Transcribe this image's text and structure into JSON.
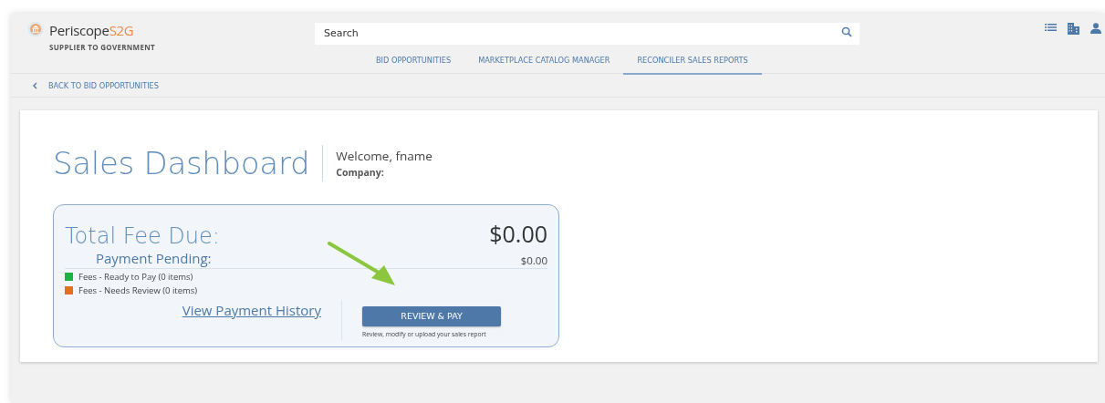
{
  "logo": {
    "name": "Periscope",
    "accent": "S2G",
    "tagline": "SUPPLIER TO GOVERNMENT"
  },
  "search": {
    "placeholder": "Search"
  },
  "tabs": [
    {
      "label": "BID OPPORTUNITIES",
      "selected": false
    },
    {
      "label": "MARKETPLACE CATALOG MANAGER",
      "selected": false
    },
    {
      "label": "RECONCILER SALES REPORTS",
      "selected": true
    }
  ],
  "back_link": "BACK TO BID OPPORTUNITIES",
  "dashboard": {
    "title": "Sales Dashboard",
    "welcome": "Welcome, fname",
    "company": "Company:"
  },
  "fee_card": {
    "total_label": "Total Fee Due:",
    "total": "$0.00",
    "pending_label": "Payment Pending:",
    "pending": "$0.00",
    "legend": [
      {
        "label": "Fees - Ready to Pay (0 items)",
        "color": "#1db343"
      },
      {
        "label": "Fees - Needs Review (0 items)",
        "color": "#e2701c"
      }
    ],
    "history_link": "View Payment History",
    "button": "REVIEW & PAY",
    "button_hint": "Review, modify or upload your sales report"
  }
}
